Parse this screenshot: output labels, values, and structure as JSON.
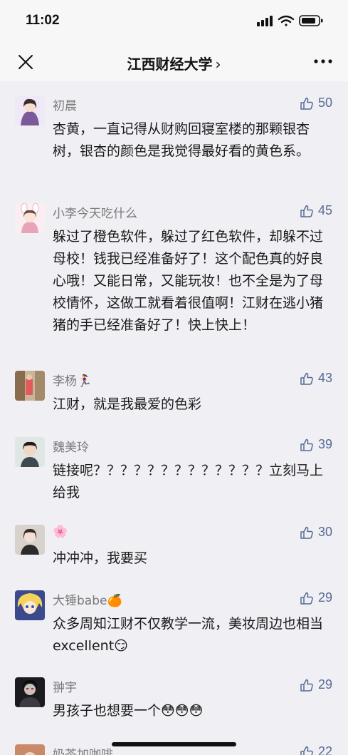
{
  "status": {
    "time": "11:02"
  },
  "nav": {
    "title": "江西财经大学",
    "chevron": "›"
  },
  "comments": [
    {
      "name": "初晨",
      "likes": "50",
      "text": "杏黄，一直记得从财购回寝室楼的那颗银杏树，银杏的颜色是我觉得最好看的黄色系。"
    },
    {
      "name": "小李今天吃什么",
      "likes": "45",
      "text": "躲过了橙色软件，躲过了红色软件，却躲不过母校！钱我已经准备好了！这个配色真的好良心哦！又能日常，又能玩妆！也不全是为了母校情怀，这做工就看着很值啊！江财在逃小猪猪的手已经准备好了！快上快上！"
    },
    {
      "name": "李杨🏃‍♀️",
      "likes": "43",
      "text": "江财，就是我最爱的色彩"
    },
    {
      "name": "魏美玲",
      "likes": "39",
      "text": "链接呢？？？？？？？？？？？？？立刻马上给我"
    },
    {
      "name": "🌸",
      "likes": "30",
      "text": "冲冲冲，我要买"
    },
    {
      "name": "大锤babe🍊",
      "likes": "29",
      "text": "众多周知江财不仅教学一流，美妆周边也相当excellent😏"
    },
    {
      "name": "翀宇",
      "likes": "29",
      "text": "男孩子也想要一个😳😳😳"
    },
    {
      "name": "奶茶加咖啡",
      "likes": "22",
      "text": ""
    }
  ]
}
